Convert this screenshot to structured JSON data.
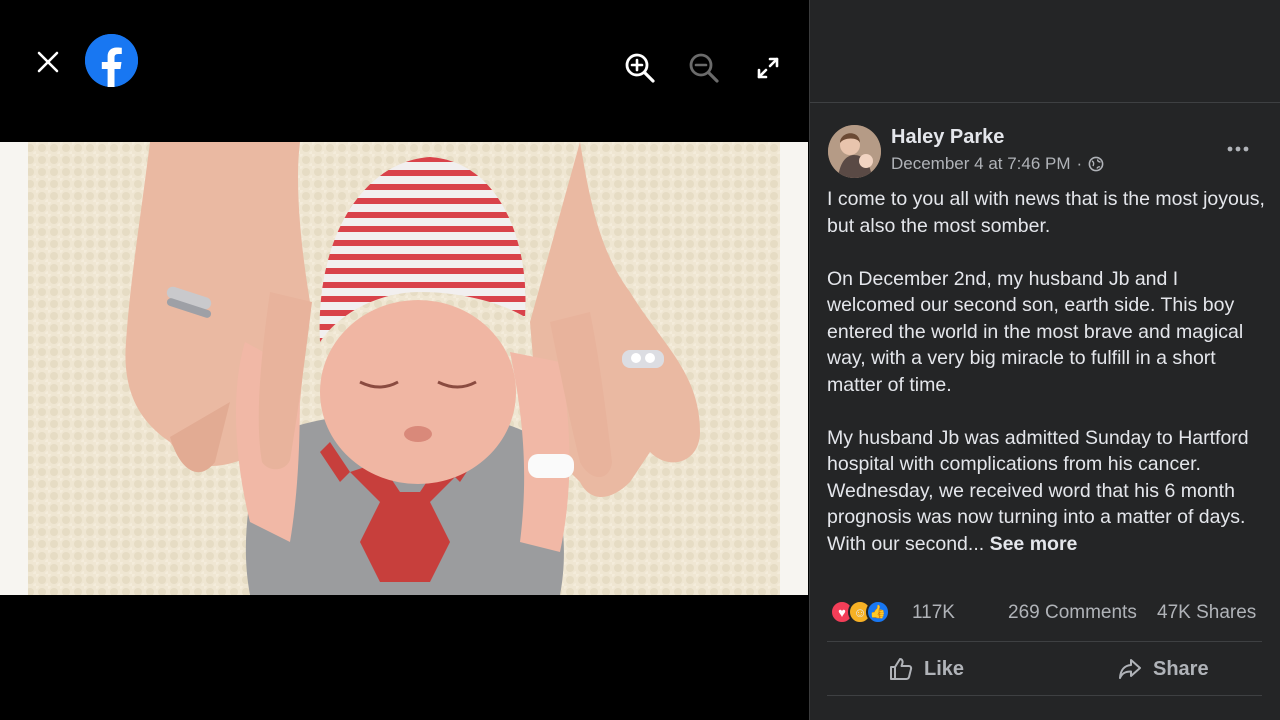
{
  "viewer": {
    "icons": {
      "close": "close-icon",
      "logo": "facebook-logo",
      "zoom_in": "zoom-in-icon",
      "zoom_out": "zoom-out-icon",
      "fullscreen": "fullscreen-icon"
    },
    "brand_color": "#1877f2"
  },
  "post": {
    "author": "Haley Parke",
    "timestamp": "December 4 at 7:46 PM",
    "separator": "·",
    "privacy_icon": "globe-icon",
    "paragraphs": [
      "I come to you all with news that is the most joyous, but also the most somber.",
      "On December 2nd, my husband Jb and I welcomed our second son, earth side. This boy entered the world in the most brave and magical way, with a very big miracle to fulfill in a short matter of time.",
      "My husband Jb was admitted Sunday to Hartford hospital with complications from his cancer. Wednesday, we received word that his 6 month prognosis was now turning into a matter of days. With our second..."
    ],
    "see_more": "See more"
  },
  "stats": {
    "reactions": [
      "love",
      "care",
      "like"
    ],
    "reaction_count": "117K",
    "comments": "269 Comments",
    "shares": "47K Shares"
  },
  "actions": {
    "like": "Like",
    "share": "Share"
  },
  "colors": {
    "panel_bg": "#242526",
    "text_primary": "#e4e6eb",
    "text_secondary": "#b0b3b8"
  }
}
